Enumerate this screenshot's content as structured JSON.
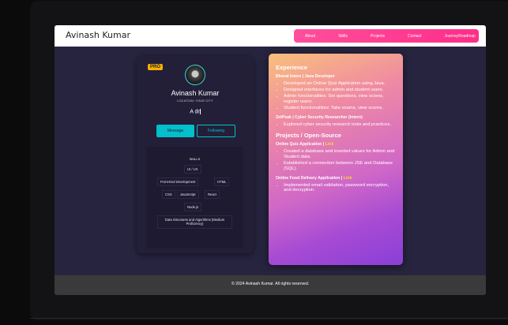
{
  "site": {
    "title": "Avinash Kumar"
  },
  "nav": [
    "About",
    "Skills",
    "Projects",
    "Contact",
    "JourneyRoadmap"
  ],
  "profile": {
    "badge": "PRO",
    "name": "Avinash Kumar",
    "location": "LOCATION: YOUR CITY",
    "typed_text": "A dr",
    "message_label": "Message",
    "following_label": "Following",
    "avatar_icon": "profile-photo"
  },
  "skills": {
    "title": "SKILLS",
    "items": [
      "UI / UX",
      "Front-End Development",
      "HTML",
      "CSS",
      "JavaScript",
      "React",
      "Node.js",
      "Data Structures and Algorithms (Medium Proficiency)"
    ]
  },
  "experience": {
    "heading": "Experience",
    "jobs": [
      {
        "title": "Bharat Intern | Java Developer",
        "points": [
          "Developed an Online Quiz Application using Java.",
          "Designed interfaces for admin and student users.",
          "Admin functionalities: Set questions, view scores, register users.",
          "Student functionalities: Take exams, view scores."
        ]
      },
      {
        "title": "ZetPeak | Cyber Security Researcher (Intern)",
        "points": [
          "Explored cyber security research tools and practices."
        ]
      }
    ]
  },
  "projects": {
    "heading": "Projects / Open-Source",
    "items": [
      {
        "title": "Online Quiz Application |",
        "link": "Link",
        "points": [
          "Created a database and inserted values for Admin and Student data.",
          "Established a connection between JSE and Database (SQL)."
        ]
      },
      {
        "title": "Online Food Delivery Application |",
        "link": "Link",
        "points": [
          "Implemented email validation, password encryption, and decryption."
        ]
      }
    ]
  },
  "footer": {
    "text": "© 2024 Avinash Kumar. All rights reserved."
  },
  "colors": {
    "nav": "#ff2d88",
    "accent": "#03bfcb",
    "badge": "#f5b200",
    "link": "#ffd52e"
  }
}
